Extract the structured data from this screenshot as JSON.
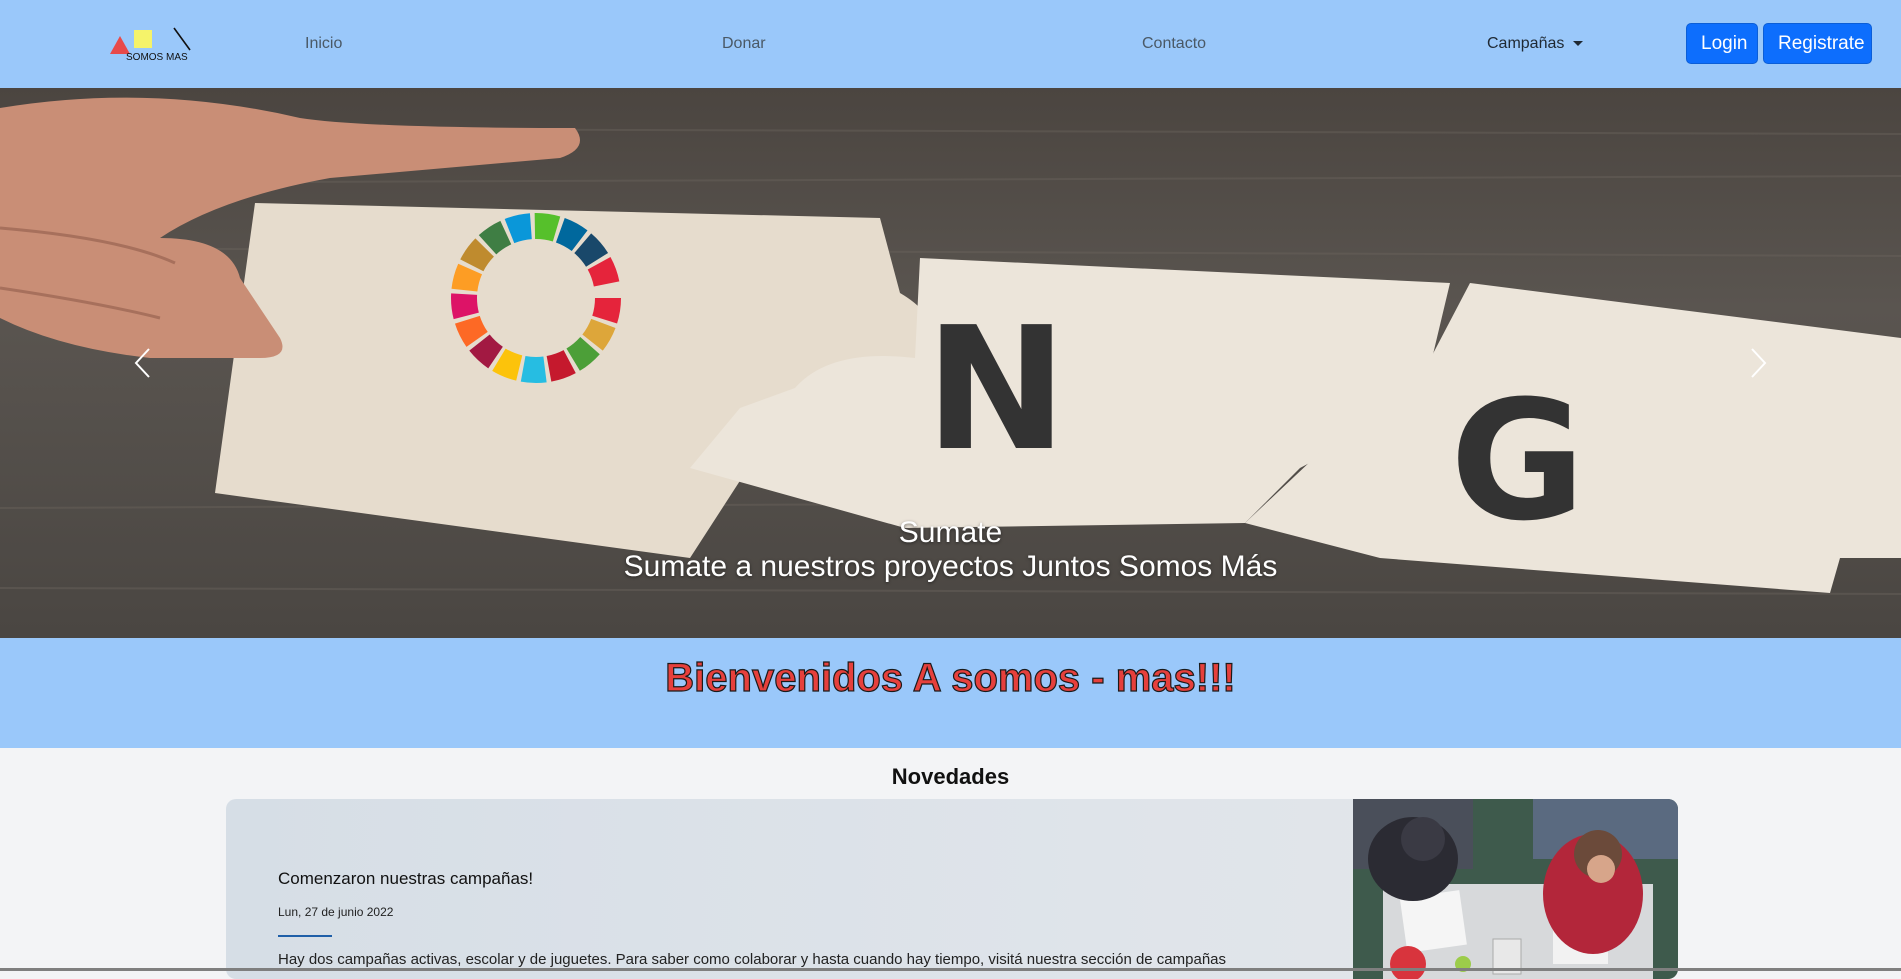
{
  "brand": {
    "logo_text": "SOMOS MAS"
  },
  "nav": {
    "links": [
      "Inicio",
      "Donar",
      "Contacto"
    ],
    "dropdown_label": "Campañas",
    "login_label": "Login",
    "register_label": "Registrate"
  },
  "carousel": {
    "caption_title": "Sumate",
    "caption_text": "Sumate a nuestros proyectos Juntos Somos Más",
    "image_letters": [
      "N",
      "G"
    ]
  },
  "welcome": {
    "title": "Bienvenidos A somos - mas!!!"
  },
  "news": {
    "heading": "Novedades",
    "items": [
      {
        "title": "Comenzaron nuestras campañas!",
        "date": "Lun, 27 de junio 2022",
        "body": "Hay dos campañas activas, escolar y de juguetes. Para saber como colaborar y hasta cuando hay tiempo, visitá nuestra sección de campañas"
      }
    ]
  },
  "colors": {
    "navbar_bg": "#9ac8fa",
    "primary_button": "#0d6efd",
    "welcome_text": "#e6403c"
  },
  "icons": [
    "chevron-left-icon",
    "chevron-right-icon",
    "caret-down-icon"
  ]
}
